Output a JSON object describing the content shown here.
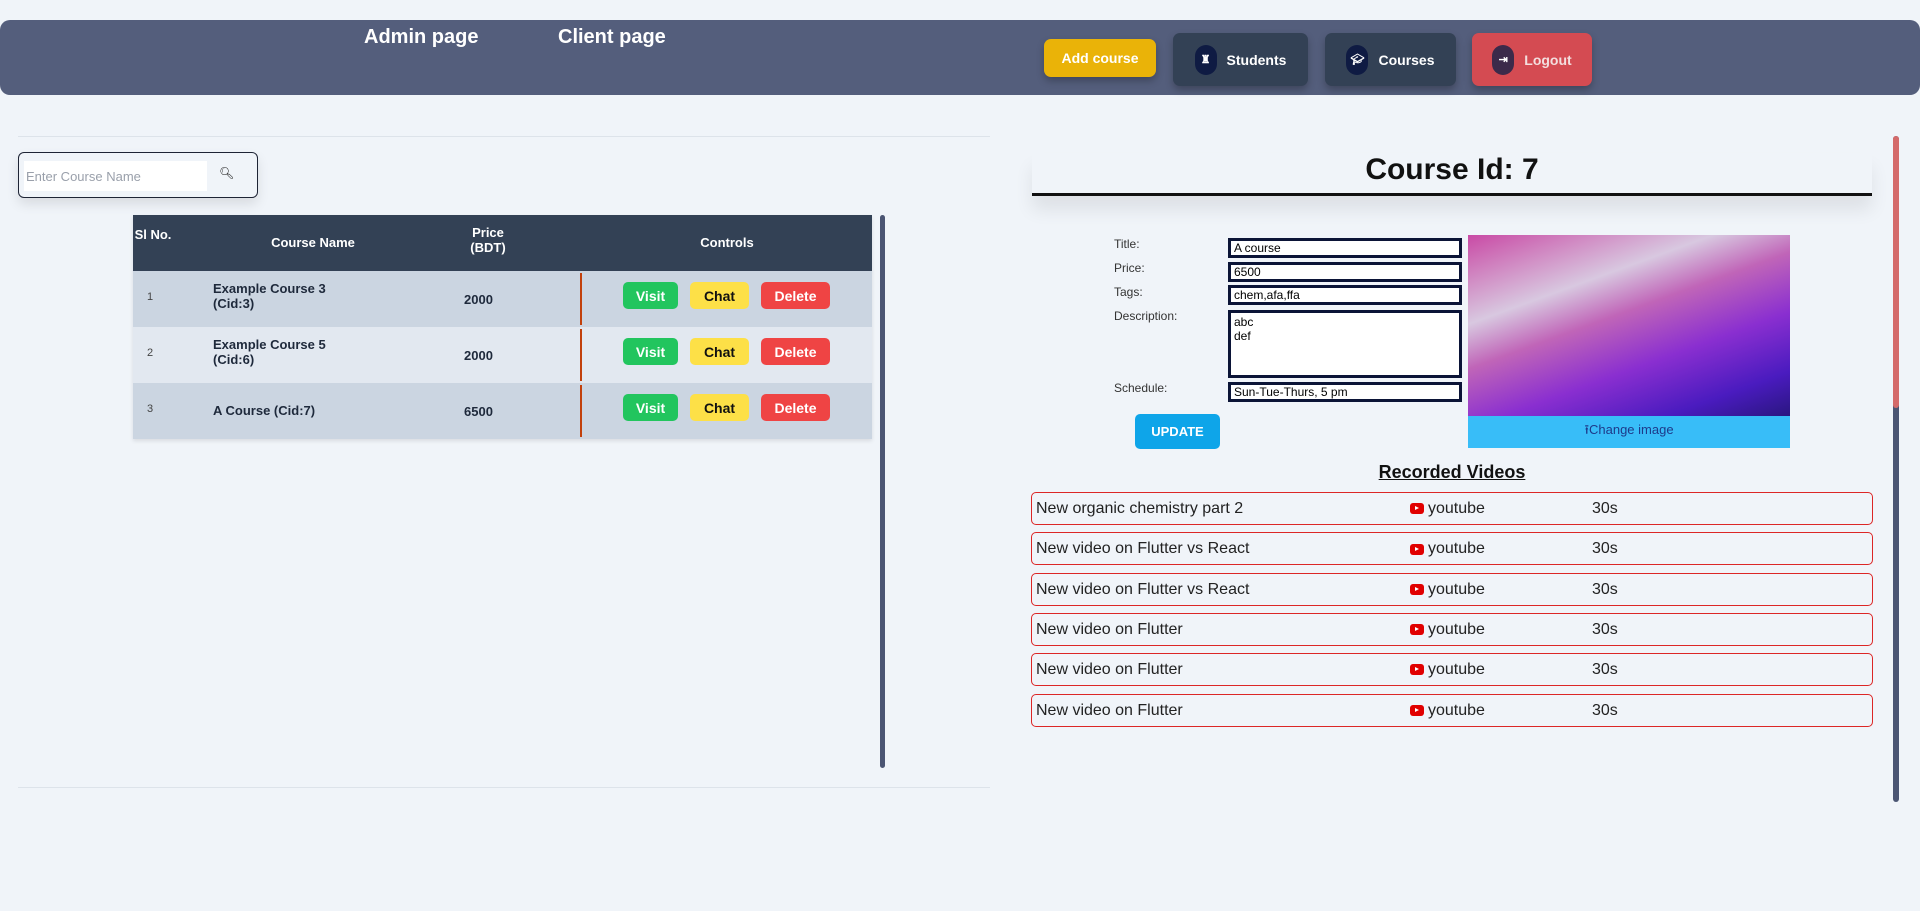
{
  "nav": {
    "admin": "Admin page",
    "client": "Client page",
    "add_course": "Add course",
    "students": "Students",
    "courses": "Courses",
    "logout": "Logout"
  },
  "search": {
    "placeholder": "Enter Course Name",
    "icon": "search-icon"
  },
  "table": {
    "headers": {
      "sl": "Sl No.",
      "name": "Course Name",
      "price": "Price (BDT)",
      "controls": "Controls"
    },
    "buttons": {
      "visit": "Visit",
      "chat": "Chat",
      "delete": "Delete"
    },
    "rows": [
      {
        "sl": "1",
        "name": "Example Course 3 (Cid:3)",
        "price": "2000"
      },
      {
        "sl": "2",
        "name": "Example Course 5 (Cid:6)",
        "price": "2000"
      },
      {
        "sl": "3",
        "name": "A Course (Cid:7)",
        "price": "6500"
      }
    ]
  },
  "detail": {
    "heading": "Course Id: 7",
    "labels": {
      "title": "Title:",
      "price": "Price:",
      "tags": "Tags:",
      "description": "Description:",
      "schedule": "Schedule:"
    },
    "values": {
      "title": "A course",
      "price": "6500",
      "tags": "chem,afa,ffa",
      "description": "abc\ndef",
      "schedule": "Sun-Tue-Thurs, 5 pm"
    },
    "update": "UPDATE",
    "change_image": "⭱Change image"
  },
  "videos": {
    "heading": "Recorded Videos",
    "items": [
      {
        "title": "New organic chemistry part 2",
        "platform": "youtube",
        "duration": "30s"
      },
      {
        "title": "New video on Flutter vs React",
        "platform": "youtube",
        "duration": "30s"
      },
      {
        "title": "New video on Flutter vs React",
        "platform": "youtube",
        "duration": "30s"
      },
      {
        "title": "New video on Flutter",
        "platform": "youtube",
        "duration": "30s"
      },
      {
        "title": "New video on Flutter",
        "platform": "youtube",
        "duration": "30s"
      },
      {
        "title": "New video on Flutter",
        "platform": "youtube",
        "duration": "30s"
      }
    ]
  },
  "colors": {
    "nav": "#545e7c",
    "add": "#eab308",
    "dark": "#334155",
    "logout": "#d44b52",
    "visit": "#22c55e",
    "chat": "#fde047",
    "delete": "#ef4444",
    "video_border": "#dc2626"
  }
}
